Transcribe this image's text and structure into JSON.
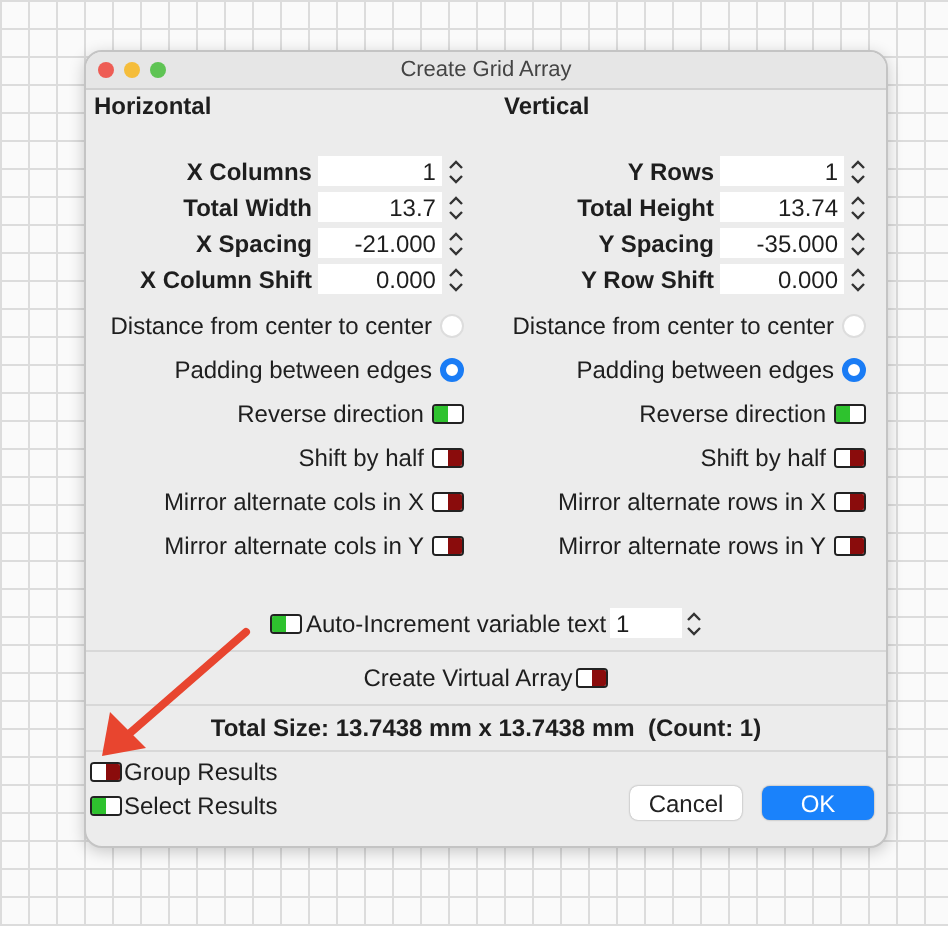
{
  "window": {
    "title": "Create Grid Array"
  },
  "columns": [
    {
      "heading": "Horizontal",
      "fields": [
        {
          "label": "X Columns",
          "value": "1"
        },
        {
          "label": "Total Width",
          "value": "13.7"
        },
        {
          "label": "X Spacing",
          "value": "-21.000"
        },
        {
          "label": "X Column Shift",
          "value": "0.000"
        }
      ],
      "spacing_options": [
        {
          "label": "Distance from center to center",
          "selected": false
        },
        {
          "label": "Padding between edges",
          "selected": true
        }
      ],
      "toggles": [
        {
          "label": "Reverse direction",
          "on": true
        },
        {
          "label": "Shift by half",
          "on": false
        },
        {
          "label": "Mirror alternate cols in X",
          "on": false
        },
        {
          "label": "Mirror alternate cols in Y",
          "on": false
        }
      ]
    },
    {
      "heading": "Vertical",
      "fields": [
        {
          "label": "Y Rows",
          "value": "1"
        },
        {
          "label": "Total Height",
          "value": "13.74"
        },
        {
          "label": "Y Spacing",
          "value": "-35.000"
        },
        {
          "label": "Y Row Shift",
          "value": "0.000"
        }
      ],
      "spacing_options": [
        {
          "label": "Distance from center to center",
          "selected": false
        },
        {
          "label": "Padding between edges",
          "selected": true
        }
      ],
      "toggles": [
        {
          "label": "Reverse direction",
          "on": true
        },
        {
          "label": "Shift by half",
          "on": false
        },
        {
          "label": "Mirror alternate rows in X",
          "on": false
        },
        {
          "label": "Mirror alternate rows in Y",
          "on": false
        }
      ]
    }
  ],
  "auto_increment": {
    "label": "Auto-Increment variable text",
    "on": true,
    "value": "1"
  },
  "virtual_array": {
    "label": "Create Virtual Array",
    "on": false
  },
  "total_size": "Total Size: 13.7438 mm x 13.7438 mm  (Count: 1)",
  "result_options": [
    {
      "label": "Group Results",
      "on": false
    },
    {
      "label": "Select Results",
      "on": true
    }
  ],
  "buttons": [
    {
      "label": "Cancel",
      "kind": "secondary"
    },
    {
      "label": "OK",
      "kind": "primary"
    }
  ]
}
